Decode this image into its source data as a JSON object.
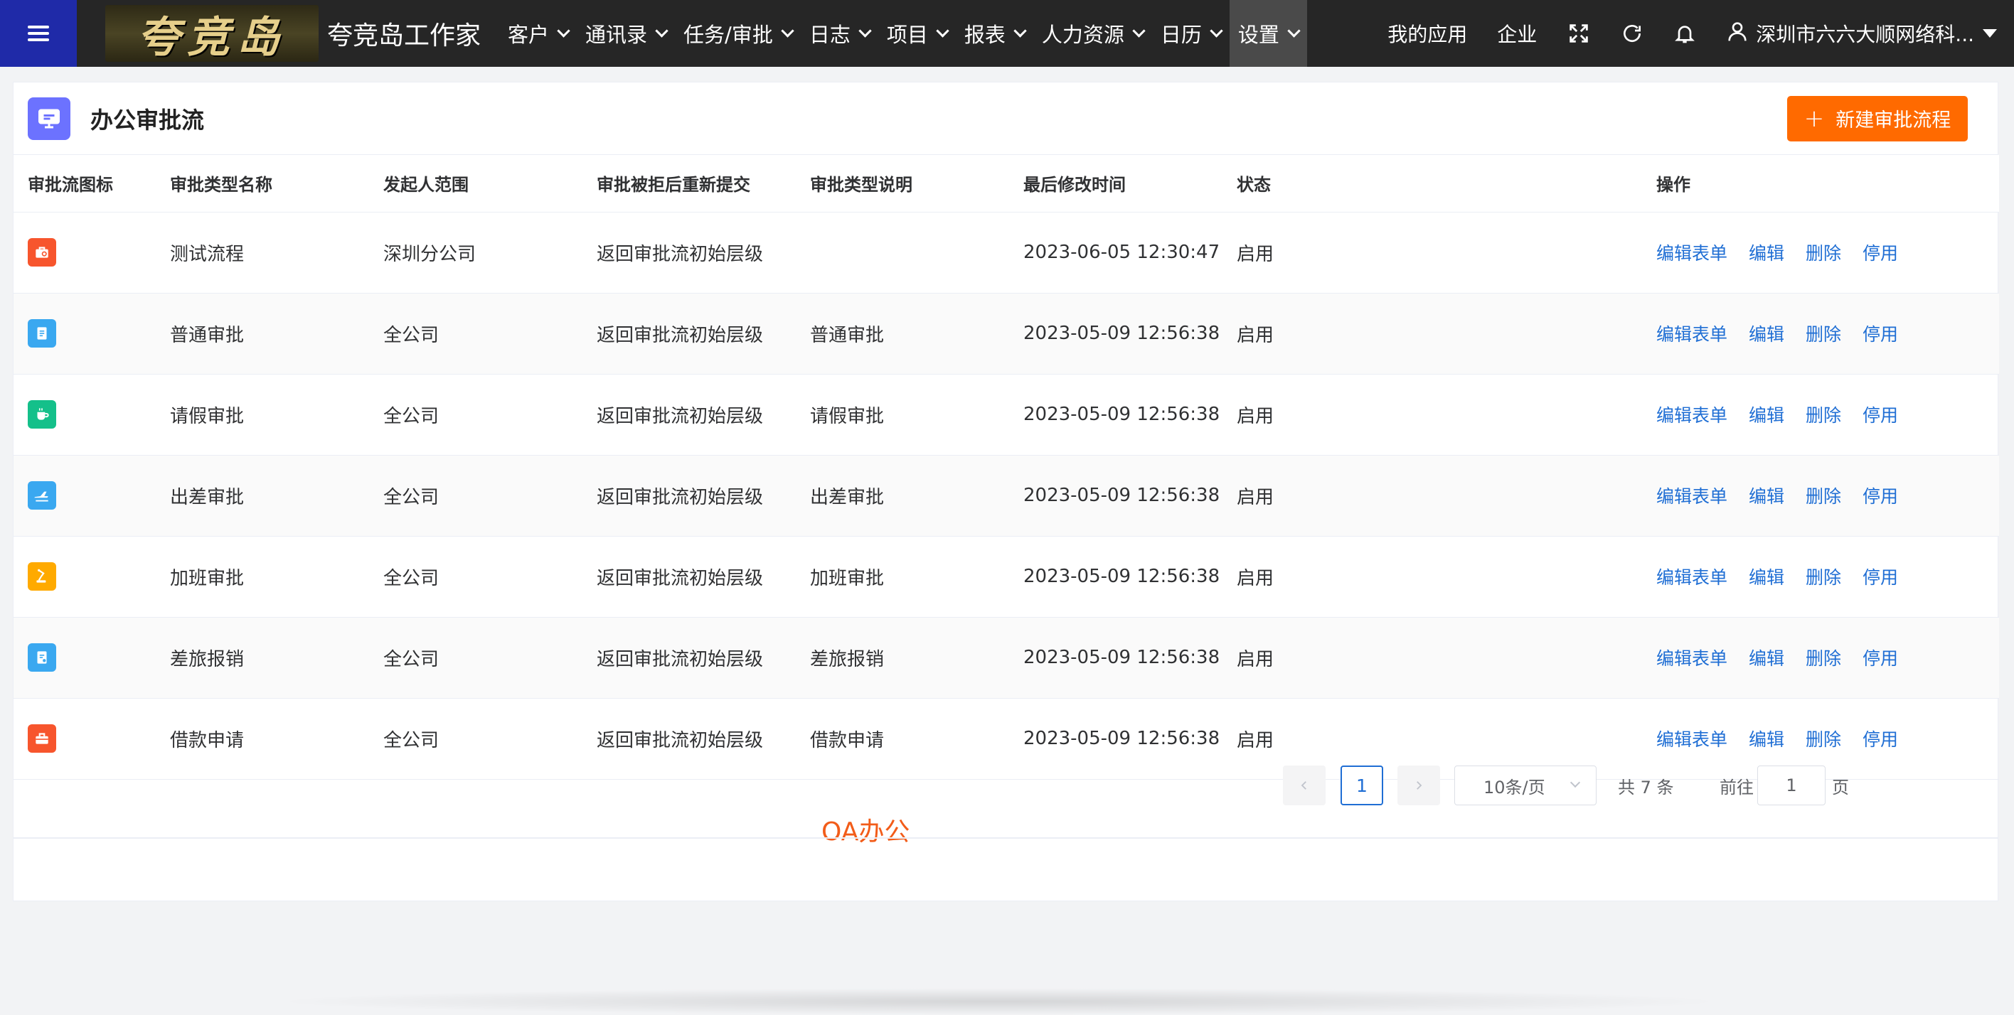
{
  "topbar": {
    "logo_text": "夸竞岛",
    "app_title": "夸竞岛工作家",
    "nav": [
      {
        "label": "客户"
      },
      {
        "label": "通讯录"
      },
      {
        "label": "任务/审批"
      },
      {
        "label": "日志"
      },
      {
        "label": "项目"
      },
      {
        "label": "报表"
      },
      {
        "label": "人力资源"
      },
      {
        "label": "日历"
      },
      {
        "label": "设置",
        "active": true
      }
    ],
    "my_apps": "我的应用",
    "enterprise": "企业",
    "user_name": "深圳市六六大顺网络科...",
    "icons": [
      "menu-icon",
      "fullscreen-icon",
      "refresh-icon",
      "bell-icon",
      "user-icon"
    ]
  },
  "page": {
    "title": "办公审批流",
    "new_button": "新建审批流程"
  },
  "table": {
    "headers": [
      "审批流图标",
      "审批类型名称",
      "发起人范围",
      "审批被拒后重新提交",
      "审批类型说明",
      "最后修改时间",
      "状态",
      "操作"
    ],
    "actions": [
      "编辑表单",
      "编辑",
      "删除",
      "停用"
    ],
    "rows": [
      {
        "icon": "briefcase-icon",
        "color": "#f7552d",
        "name": "测试流程",
        "scope": "深圳分公司",
        "resubmit": "返回审批流初始层级",
        "desc": "",
        "time": "2023-06-05 12:30:47",
        "status": "启用"
      },
      {
        "icon": "document-icon",
        "color": "#3aa8f0",
        "name": "普通审批",
        "scope": "全公司",
        "resubmit": "返回审批流初始层级",
        "desc": "普通审批",
        "time": "2023-05-09 12:56:38",
        "status": "启用"
      },
      {
        "icon": "cup-icon",
        "color": "#14c08a",
        "name": "请假审批",
        "scope": "全公司",
        "resubmit": "返回审批流初始层级",
        "desc": "请假审批",
        "time": "2023-05-09 12:56:38",
        "status": "启用"
      },
      {
        "icon": "plane-icon",
        "color": "#3aa8f0",
        "name": "出差审批",
        "scope": "全公司",
        "resubmit": "返回审批流初始层级",
        "desc": "出差审批",
        "time": "2023-05-09 12:56:38",
        "status": "启用"
      },
      {
        "icon": "lamp-icon",
        "color": "#ffaa00",
        "name": "加班审批",
        "scope": "全公司",
        "resubmit": "返回审批流初始层级",
        "desc": "加班审批",
        "time": "2023-05-09 12:56:38",
        "status": "启用"
      },
      {
        "icon": "receipt-icon",
        "color": "#3aa8f0",
        "name": "差旅报销",
        "scope": "全公司",
        "resubmit": "返回审批流初始层级",
        "desc": "差旅报销",
        "time": "2023-05-09 12:56:38",
        "status": "启用"
      },
      {
        "icon": "toolbox-icon",
        "color": "#f7552d",
        "name": "借款申请",
        "scope": "全公司",
        "resubmit": "返回审批流初始层级",
        "desc": "借款申请",
        "time": "2023-05-09 12:56:38",
        "status": "启用"
      }
    ]
  },
  "watermark": "OA办公",
  "pagination": {
    "current_page": "1",
    "page_size": "10条/页",
    "total": "共 7 条",
    "goto_label": "前往",
    "goto_value": "1",
    "page_suffix": "页"
  },
  "colors": {
    "accent": "#1f6ed4",
    "primary_button": "#ff6a00",
    "topbar": "#262626",
    "menu_button": "#1f2aa8"
  }
}
